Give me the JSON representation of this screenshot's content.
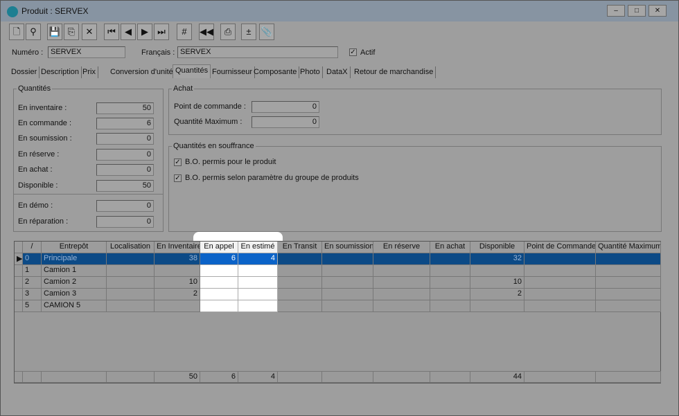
{
  "window": {
    "title": "Produit : SERVEX",
    "controls": [
      "–",
      "□",
      "✕"
    ]
  },
  "toolbar": [
    {
      "name": "new",
      "glyph": "🗋"
    },
    {
      "name": "search",
      "glyph": "⚲"
    },
    {
      "name": "save",
      "glyph": "💾"
    },
    {
      "name": "export",
      "glyph": "⎘"
    },
    {
      "name": "delete",
      "glyph": "✕"
    },
    {
      "name": "first",
      "glyph": "⏮"
    },
    {
      "name": "previous",
      "glyph": "◀"
    },
    {
      "name": "next",
      "glyph": "▶"
    },
    {
      "name": "last",
      "glyph": "⏭"
    },
    {
      "name": "renumber",
      "glyph": "#"
    },
    {
      "name": "rewind",
      "glyph": "◀◀"
    },
    {
      "name": "print",
      "glyph": "⎙"
    },
    {
      "name": "adjust",
      "glyph": "±"
    },
    {
      "name": "attach",
      "glyph": "📎"
    }
  ],
  "header": {
    "numero_label": "Numéro :",
    "numero_value": "SERVEX",
    "francais_label": "Français :",
    "francais_value": "SERVEX",
    "actif_label": "Actif",
    "actif_checked": true
  },
  "tabs": [
    "Dossier",
    "Description",
    "Prix",
    "Conversion d'unité",
    "Quantités",
    "Fournisseur",
    "Composante",
    "Photo",
    "DataX",
    "Retour de marchandise"
  ],
  "active_tab": "Quantités",
  "quantites": {
    "title": "Quantités",
    "rows": [
      {
        "label": "En inventaire :",
        "value": "50"
      },
      {
        "label": "En commande :",
        "value": "6"
      },
      {
        "label": "En soumission :",
        "value": "0"
      },
      {
        "label": "En réserve :",
        "value": "0"
      },
      {
        "label": "En achat :",
        "value": "0"
      },
      {
        "label": "Disponible :",
        "value": "50"
      },
      {
        "label": "En démo :",
        "value": "0"
      },
      {
        "label": "En réparation :",
        "value": "0"
      }
    ]
  },
  "achat": {
    "title": "Achat",
    "rows": [
      {
        "label": "Point de commande :",
        "value": "0"
      },
      {
        "label": "Quantité Maximum :",
        "value": "0"
      }
    ]
  },
  "souffrance": {
    "title": "Quantités en souffrance",
    "options": [
      {
        "label": "B.O. permis pour le produit",
        "checked": true
      },
      {
        "label": "B.O. permis selon paramètre du groupe de produits",
        "checked": true
      }
    ]
  },
  "grid": {
    "columns": [
      "",
      "/",
      "Entrepôt",
      "Localisation",
      "En Inventaire",
      "En appel",
      "En estimé",
      "En Transit",
      "En soumission",
      "En réserve",
      "En achat",
      "Disponible",
      "Point de Commande",
      "Quantité Maximum"
    ],
    "rows": [
      [
        "▶",
        "0",
        "Principale",
        "",
        "38",
        "6",
        "4",
        "",
        "",
        "",
        "",
        "32",
        "",
        ""
      ],
      [
        "",
        "1",
        "Camion 1",
        "",
        "",
        "",
        "",
        "",
        "",
        "",
        "",
        "",
        "",
        ""
      ],
      [
        "",
        "2",
        "Camion 2",
        "",
        "10",
        "",
        "",
        "",
        "",
        "",
        "",
        "10",
        "",
        ""
      ],
      [
        "",
        "3",
        "Camion 3",
        "",
        "2",
        "",
        "",
        "",
        "",
        "",
        "",
        "2",
        "",
        ""
      ],
      [
        "",
        "5",
        "CAMION 5",
        "",
        "",
        "",
        "",
        "",
        "",
        "",
        "",
        "",
        "",
        ""
      ]
    ],
    "selected_row": 0,
    "highlighted_columns": [
      "En appel",
      "En estimé"
    ],
    "totals": [
      "",
      "",
      "",
      "",
      "50",
      "6",
      "4",
      "",
      "",
      "",
      "",
      "44",
      "",
      ""
    ]
  },
  "colors": {
    "selection": "#0c4a86",
    "highlight": "#ffffff"
  }
}
